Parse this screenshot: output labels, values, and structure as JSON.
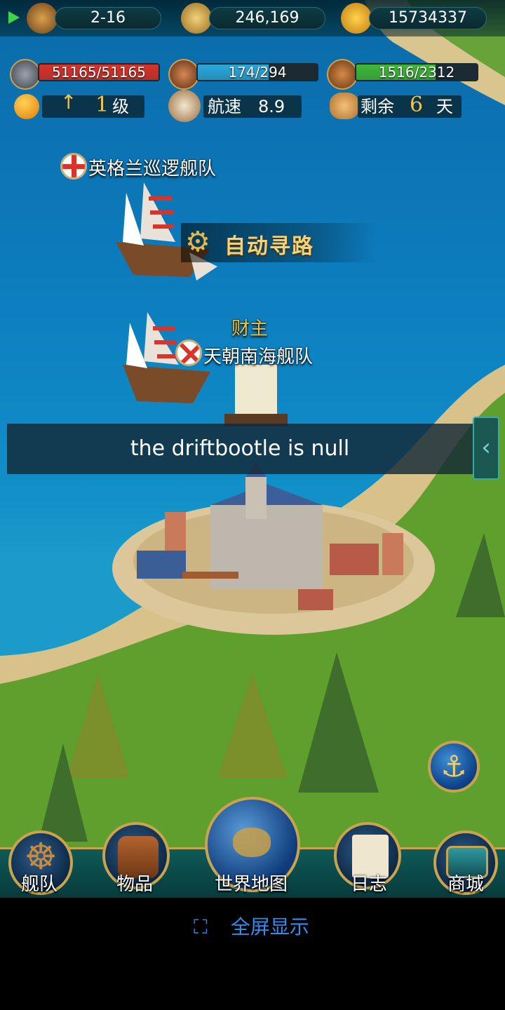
{
  "top_bar": {
    "stage": "2-16",
    "compass_value": "246,169",
    "gold_value": "15734337"
  },
  "stats": {
    "durability": {
      "text": "51165/51165",
      "fraction": 1.0,
      "color": "#d8322a"
    },
    "sailors": {
      "text": "174/294",
      "fraction": 0.592,
      "color": "#2aa7dc"
    },
    "cargo": {
      "text": "1516/2312",
      "fraction": 0.656,
      "color": "#3fb83a"
    }
  },
  "info": {
    "level_number": "1",
    "level_unit": "级",
    "speed_label": "航速",
    "speed_value": "8.9",
    "remaining_label": "剩余",
    "remaining_value": "6",
    "remaining_unit": "天"
  },
  "fleets": {
    "player_fleet_name": "英格兰巡逻舰队",
    "auto_route_label": "自动寻路",
    "npc_title": "财主",
    "npc_fleet_name": "天朝南海舰队"
  },
  "toast": {
    "message": "the driftbootle is null"
  },
  "nav": {
    "fleet": "舰队",
    "items": "物品",
    "world_map": "世界地图",
    "log": "日志",
    "shop": "商城"
  },
  "footer": {
    "fullscreen_label": "全屏显示"
  }
}
